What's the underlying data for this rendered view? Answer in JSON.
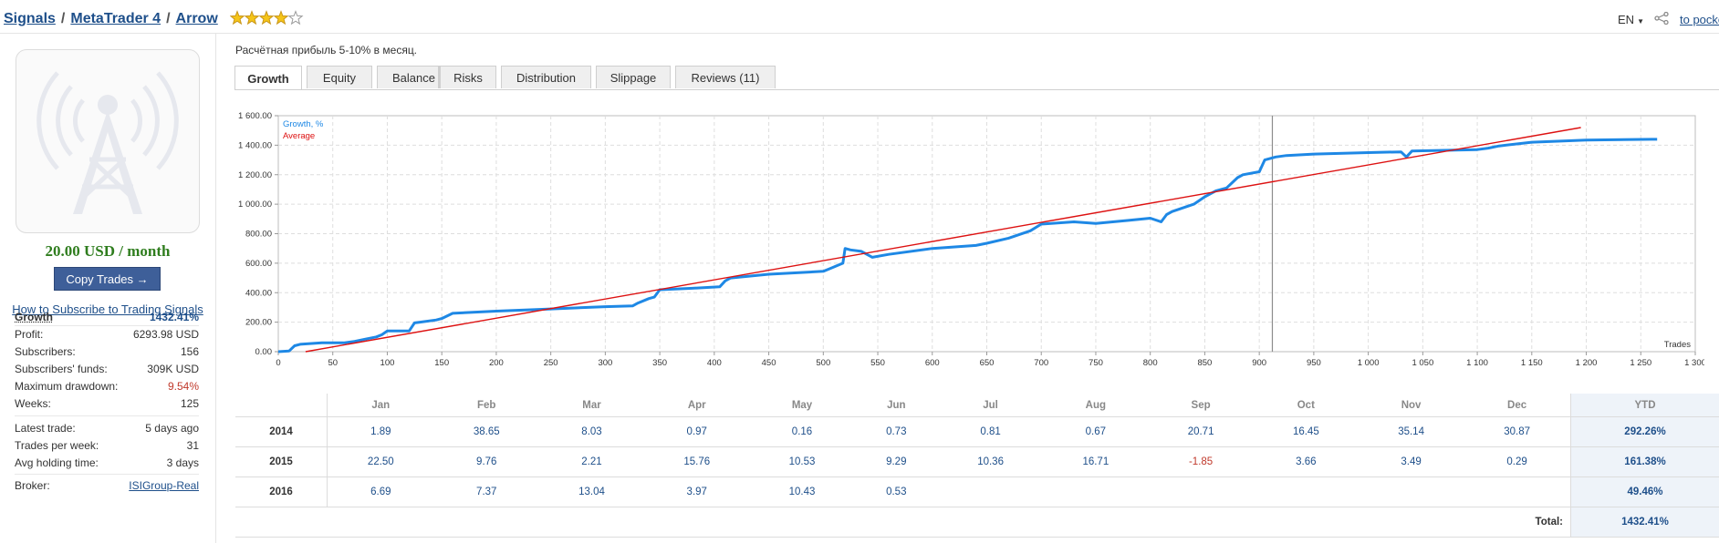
{
  "breadcrumb": {
    "signals": "Signals",
    "platform": "MetaTrader 4",
    "name": "Arrow",
    "sep1": "/",
    "sep2": "/"
  },
  "rating": {
    "stars": 4,
    "max": 5
  },
  "header": {
    "language": "EN",
    "pocket": "to pocke"
  },
  "sidebar": {
    "price": "20.00 USD / month",
    "copy_button": "Copy Trades →",
    "how_to": "How to Subscribe to Trading Signals",
    "stats": [
      {
        "label": "Growth",
        "value": "1432.41%"
      },
      {
        "label": "Profit:",
        "value": "6293.98 USD"
      },
      {
        "label": "Subscribers:",
        "value": "156"
      },
      {
        "label": "Subscribers' funds:",
        "value": "309K USD"
      },
      {
        "label": "Maximum drawdown:",
        "value": "9.54%"
      },
      {
        "label": "Weeks:",
        "value": "125"
      },
      {
        "label": "Latest trade:",
        "value": "5 days ago"
      },
      {
        "label": "Trades per week:",
        "value": "31"
      },
      {
        "label": "Avg holding time:",
        "value": "3 days"
      },
      {
        "label": "Broker:",
        "value": "ISIGroup-Real"
      }
    ],
    "colors": {
      "growth": "#1e4f8a",
      "drawdown": "#c0392b",
      "price": "#2f7d1e"
    }
  },
  "description": "Расчётная прибыль 5-10% в месяц.",
  "tabs": [
    {
      "label": "Growth",
      "active": true
    },
    {
      "label": "Equity"
    },
    {
      "label": "Balance"
    },
    {
      "label": "Risks"
    },
    {
      "label": "Distribution"
    },
    {
      "label": "Slippage"
    },
    {
      "label": "Reviews (11)"
    }
  ],
  "chart_data": {
    "type": "line",
    "title": "",
    "xlabel": "Trades",
    "ylabel": "",
    "xlim": [
      0,
      1300
    ],
    "ylim": [
      0,
      1600
    ],
    "x_ticks": [
      0,
      50,
      100,
      150,
      200,
      250,
      300,
      350,
      400,
      450,
      500,
      550,
      600,
      650,
      700,
      750,
      800,
      850,
      900,
      950,
      1000,
      1050,
      1100,
      1150,
      1200,
      1250,
      1300
    ],
    "x_tick_labels": [
      "0",
      "50",
      "100",
      "150",
      "200",
      "250",
      "300",
      "350",
      "400",
      "450",
      "500",
      "550",
      "600",
      "650",
      "700",
      "750",
      "800",
      "850",
      "900",
      "950",
      "1 000",
      "1 050",
      "1 100",
      "1 150",
      "1 200",
      "1 250",
      "1 300"
    ],
    "y_ticks": [
      0,
      200,
      400,
      600,
      800,
      1000,
      1200,
      1400,
      1600
    ],
    "y_tick_labels": [
      "0.00",
      "200.00",
      "400.00",
      "600.00",
      "800.00",
      "1 000.00",
      "1 200.00",
      "1 400.00",
      "1 600.00"
    ],
    "grid": true,
    "legend_position": "top-left",
    "marker_x": 912,
    "series": [
      {
        "name": "Growth, %",
        "color": "#1e88e5",
        "x": [
          0,
          10,
          15,
          20,
          40,
          60,
          70,
          80,
          90,
          95,
          100,
          120,
          125,
          130,
          145,
          150,
          160,
          200,
          250,
          300,
          325,
          330,
          340,
          345,
          350,
          380,
          405,
          410,
          415,
          450,
          500,
          505,
          510,
          518,
          520,
          525,
          535,
          540,
          545,
          560,
          600,
          640,
          650,
          670,
          690,
          700,
          730,
          750,
          780,
          800,
          810,
          815,
          820,
          840,
          850,
          860,
          870,
          880,
          885,
          900,
          905,
          915,
          925,
          950,
          1000,
          1030,
          1035,
          1040,
          1100,
          1110,
          1120,
          1150,
          1200,
          1260,
          1265
        ],
        "y": [
          0,
          5,
          40,
          50,
          60,
          60,
          70,
          85,
          100,
          115,
          140,
          140,
          195,
          200,
          215,
          225,
          260,
          275,
          290,
          305,
          310,
          330,
          360,
          370,
          420,
          430,
          440,
          480,
          500,
          525,
          545,
          560,
          575,
          600,
          700,
          690,
          680,
          660,
          640,
          660,
          700,
          720,
          735,
          770,
          820,
          865,
          880,
          870,
          890,
          905,
          880,
          930,
          950,
          1000,
          1050,
          1090,
          1110,
          1180,
          1200,
          1220,
          1300,
          1320,
          1330,
          1340,
          1350,
          1355,
          1320,
          1360,
          1370,
          1380,
          1395,
          1420,
          1435,
          1440,
          1440
        ]
      },
      {
        "name": "Average",
        "color": "#dd1111",
        "x": [
          25,
          1195
        ],
        "y": [
          0,
          1520
        ]
      }
    ]
  },
  "monthly_table": {
    "columns": [
      "",
      "Jan",
      "Feb",
      "Mar",
      "Apr",
      "May",
      "Jun",
      "Jul",
      "Aug",
      "Sep",
      "Oct",
      "Nov",
      "Dec",
      "YTD"
    ],
    "rows": [
      {
        "year": "2014",
        "values": [
          "1.89",
          "38.65",
          "8.03",
          "0.97",
          "0.16",
          "0.73",
          "0.81",
          "0.67",
          "20.71",
          "16.45",
          "35.14",
          "30.87"
        ],
        "ytd": "292.26%"
      },
      {
        "year": "2015",
        "values": [
          "22.50",
          "9.76",
          "2.21",
          "15.76",
          "10.53",
          "9.29",
          "10.36",
          "16.71",
          "-1.85",
          "3.66",
          "3.49",
          "0.29"
        ],
        "ytd": "161.38%"
      },
      {
        "year": "2016",
        "values": [
          "6.69",
          "7.37",
          "13.04",
          "3.97",
          "10.43",
          "0.53",
          "",
          "",
          "",
          "",
          "",
          ""
        ],
        "ytd": "49.46%"
      }
    ],
    "total_label": "Total:",
    "total_value": "1432.41%"
  }
}
